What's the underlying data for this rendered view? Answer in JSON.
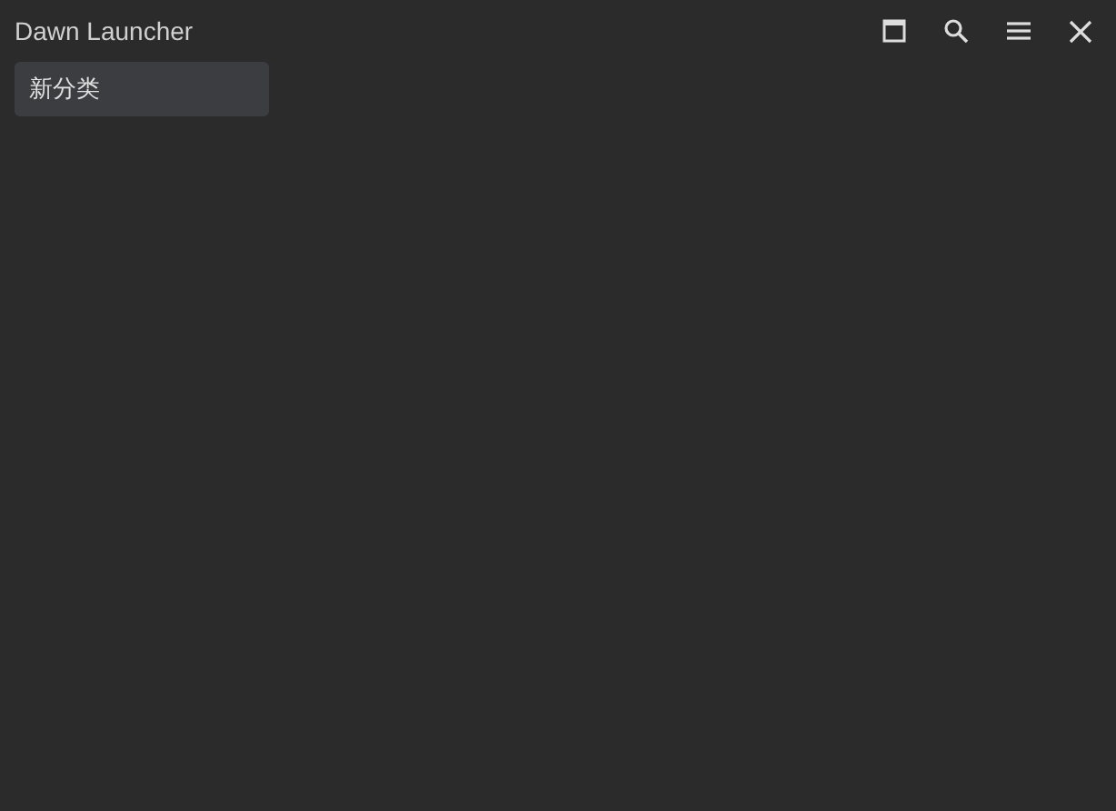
{
  "window": {
    "title": "Dawn Launcher"
  },
  "toolbar": [
    {
      "kind": "window"
    },
    {
      "kind": "search"
    },
    {
      "kind": "menu"
    },
    {
      "kind": "close"
    }
  ],
  "categories": [
    {
      "label": "新分类",
      "selected": true
    }
  ]
}
